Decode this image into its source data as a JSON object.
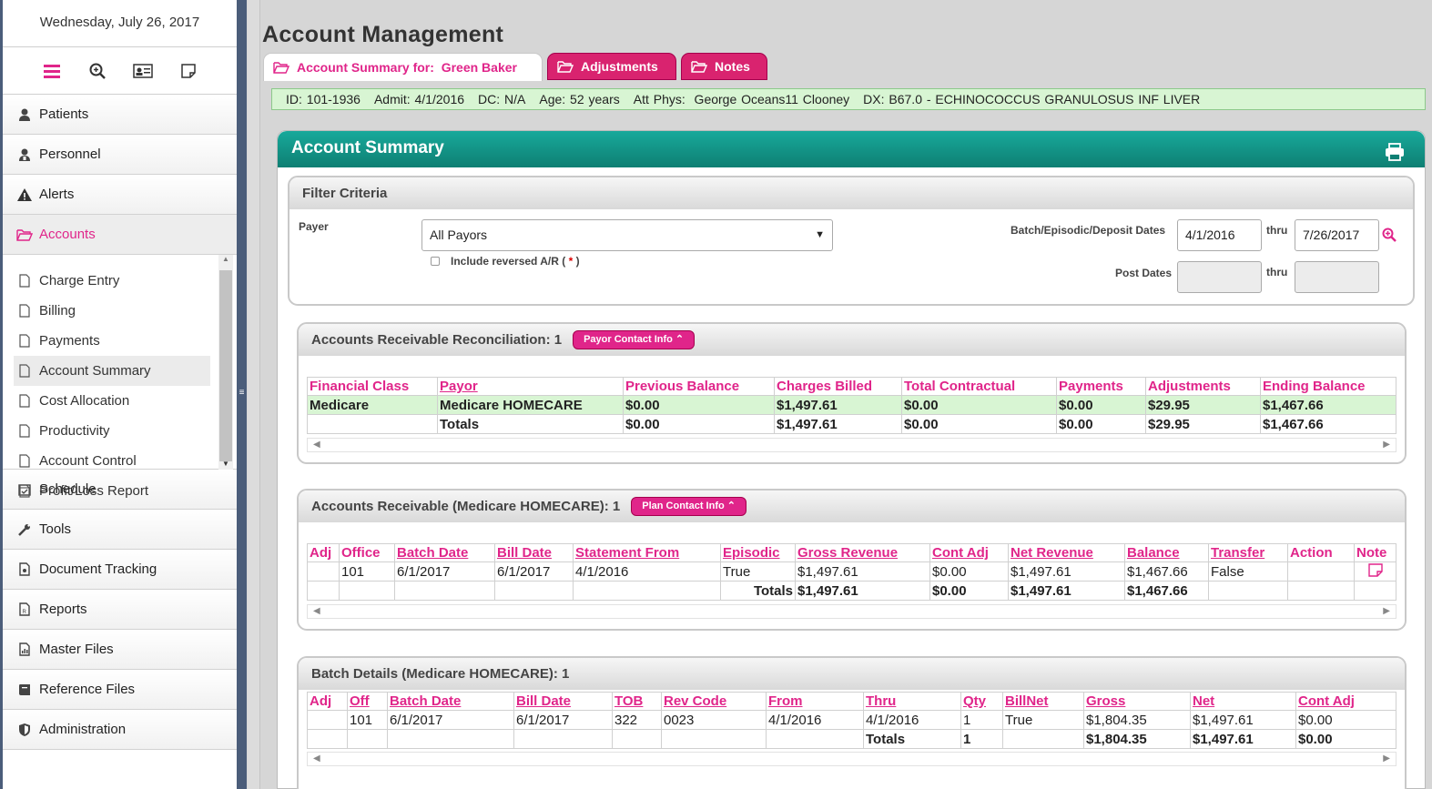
{
  "sidebar": {
    "date": "Wednesday, July 26, 2017",
    "toolbar_icons": [
      "menu-icon",
      "search-zoom-icon",
      "id-card-icon",
      "sticky-note-icon"
    ],
    "nav": [
      {
        "label": "Patients",
        "icon": "user-icon"
      },
      {
        "label": "Personnel",
        "icon": "personnel-icon"
      },
      {
        "label": "Alerts",
        "icon": "warning-icon"
      },
      {
        "label": "Accounts",
        "icon": "folder-open-icon",
        "active": true
      }
    ],
    "submenu": [
      "Charge Entry",
      "Billing",
      "Payments",
      "Account Summary",
      "Cost Allocation",
      "Productivity",
      "Account Control",
      "Profit/Loss Report"
    ],
    "selected_sub": "Account Summary",
    "nav_bottom": [
      {
        "label": "Schedule",
        "icon": "calendar-icon"
      },
      {
        "label": "Tools",
        "icon": "wrench-icon"
      },
      {
        "label": "Document Tracking",
        "icon": "document-icon"
      },
      {
        "label": "Reports",
        "icon": "report-icon"
      },
      {
        "label": "Master Files",
        "icon": "chart-file-icon"
      },
      {
        "label": "Reference Files",
        "icon": "book-icon"
      },
      {
        "label": "Administration",
        "icon": "shield-icon"
      }
    ]
  },
  "page": {
    "title": "Account Management",
    "tabs": [
      {
        "label": "Account Summary for:  Green Baker"
      },
      {
        "label": "Adjustments"
      },
      {
        "label": "Notes"
      }
    ],
    "info": {
      "id": "ID: 101-1936",
      "admit": "Admit: 4/1/2016",
      "dc": "DC: N/A",
      "age": "Age: 52 years",
      "phys": "Att Phys:  George Oceans11 Clooney",
      "dx": "DX: B67.0 - ECHINOCOCCUS GRANULOSUS INF LIVER"
    }
  },
  "summary": {
    "title": "Account Summary",
    "filter": {
      "title": "Filter Criteria",
      "payer_label": "Payer",
      "payer_value": "All Payors",
      "include_reversed": "Include reversed A/R (",
      "include_reversed_mark": "*",
      "include_reversed_end": ")",
      "dates_label": "Batch/Episodic/Deposit Dates",
      "date_from": "4/1/2016",
      "thru": "thru",
      "date_to": "7/26/2017",
      "post_label": "Post Dates",
      "post_from": "",
      "post_to": ""
    },
    "ar_recon": {
      "title": "Accounts Receivable Reconciliation: 1",
      "button": "Payor Contact Info ⌃",
      "headers": [
        "Financial Class",
        "Payor",
        "Previous Balance",
        "Charges Billed",
        "Total Contractual",
        "Payments",
        "Adjustments",
        "Ending Balance"
      ],
      "rows": [
        [
          "Medicare",
          "Medicare HOMECARE",
          "$0.00",
          "$1,497.61",
          "$0.00",
          "$0.00",
          "$29.95",
          "$1,467.66"
        ],
        [
          "",
          "Totals",
          "$0.00",
          "$1,497.61",
          "$0.00",
          "$0.00",
          "$29.95",
          "$1,467.66"
        ]
      ]
    },
    "ar": {
      "title": "Accounts Receivable (Medicare HOMECARE): 1",
      "button": "Plan Contact Info ⌃",
      "headers": [
        "Adj",
        "Office",
        "Batch Date",
        "Bill Date",
        "Statement From",
        "Episodic",
        "Gross Revenue",
        "Cont Adj",
        "Net Revenue",
        "Balance",
        "Transfer",
        "Action",
        "Note"
      ],
      "rows": [
        [
          "",
          "101",
          "6/1/2017",
          "6/1/2017",
          "4/1/2016",
          "True",
          "$1,497.61",
          "$0.00",
          "$1,497.61",
          "$1,467.66",
          "False",
          "",
          ""
        ],
        [
          "",
          "",
          "",
          "",
          "",
          "Totals",
          "$1,497.61",
          "$0.00",
          "$1,497.61",
          "$1,467.66",
          "",
          "",
          ""
        ]
      ]
    },
    "batch": {
      "title": "Batch Details (Medicare HOMECARE): 1",
      "headers": [
        "Adj",
        "Off",
        "Batch Date",
        "Bill Date",
        "TOB",
        "Rev Code",
        "From",
        "Thru",
        "Qty",
        "BillNet",
        "Gross",
        "Net",
        "Cont Adj"
      ],
      "rows": [
        [
          "",
          "101",
          "6/1/2017",
          "6/1/2017",
          "322",
          "0023",
          "4/1/2016",
          "4/1/2016",
          "1",
          "True",
          "$1,804.35",
          "$1,497.61",
          "$0.00"
        ],
        [
          "",
          "",
          "",
          "",
          "",
          "",
          "",
          "Totals",
          "1",
          "",
          "$1,804.35",
          "$1,497.61",
          "$0.00"
        ]
      ]
    }
  }
}
